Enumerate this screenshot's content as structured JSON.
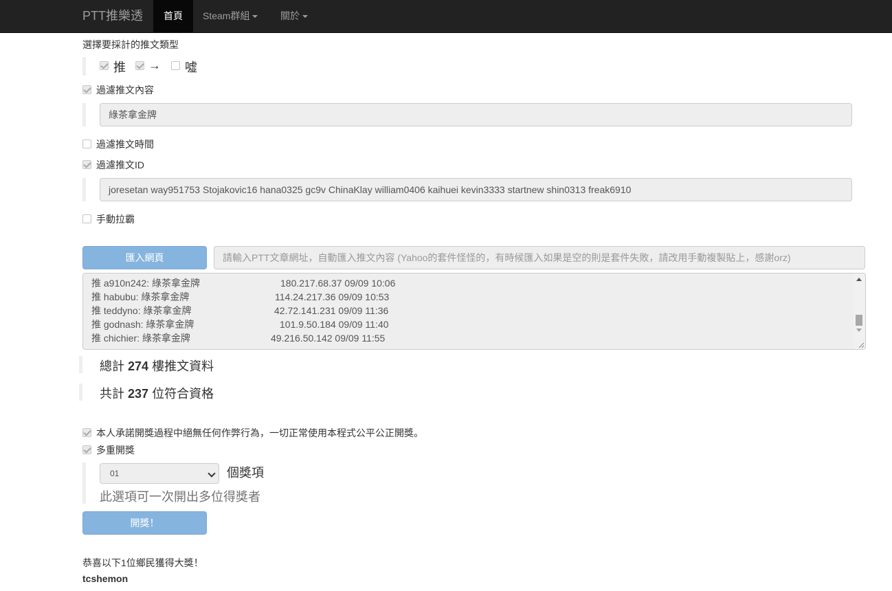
{
  "navbar": {
    "brand": "PTT推樂透",
    "items": [
      {
        "label": "首頁",
        "active": true
      },
      {
        "label": "Steam群組",
        "dropdown": true
      },
      {
        "label": "關於",
        "dropdown": true
      }
    ]
  },
  "push_type": {
    "label": "選擇要採計的推文類型",
    "options": [
      {
        "label": "推",
        "checked": true
      },
      {
        "label": "→",
        "checked": true
      },
      {
        "label": "噓",
        "checked": false
      }
    ]
  },
  "filter_content": {
    "label": "過濾推文內容",
    "checked": true,
    "value": "綠茶拿金牌"
  },
  "filter_time": {
    "label": "過濾推文時間",
    "checked": false
  },
  "filter_id": {
    "label": "過濾推文ID",
    "checked": true,
    "value": "joresetan way951753 Stojakovic16 hana0325 gc9v ChinaKlay william0406 kaihuei kevin3333 startnew shin0313 freak6910"
  },
  "manual": {
    "label": "手動拉霸",
    "checked": false
  },
  "import": {
    "button_label": "匯入網頁",
    "placeholder": "請輸入PTT文章網址，自動匯入推文內容 (Yahoo的套件怪怪的，有時候匯入如果是空的則是套件失敗，請改用手動複製貼上，感謝orz)"
  },
  "pushes": [
    {
      "text": "推 a910n242: 綠茶拿金牌",
      "meta": "180.217.68.37 09/09 10:06"
    },
    {
      "text": "推 habubu: 綠茶拿金牌",
      "meta": "114.24.217.36 09/09 10:53"
    },
    {
      "text": "推 teddyno: 綠茶拿金牌",
      "meta": "42.72.141.231 09/09 11:36"
    },
    {
      "text": "推 godnash: 綠茶拿金牌",
      "meta": "101.9.50.184 09/09 11:40"
    },
    {
      "text": "推 chichier: 綠茶拿金牌",
      "meta": "49.216.50.142 09/09 11:55"
    }
  ],
  "stats": {
    "total_prefix": "總計",
    "total_count": "274",
    "total_suffix": "樓推文資料",
    "qualified_prefix": "共計",
    "qualified_count": "237",
    "qualified_suffix": "位符合資格"
  },
  "pledge": {
    "label": "本人承諾開獎過程中絕無任何作弊行為，一切正常使用本程式公平公正開獎。",
    "checked": true
  },
  "multi": {
    "label": "多重開獎",
    "checked": true,
    "selected": "01",
    "suffix": "個獎項",
    "help": "此選項可一次開出多位得獎者"
  },
  "draw_button": "開獎！",
  "result": {
    "message": "恭喜以下1位鄉民獲得大獎！",
    "winner": "tcshemon"
  }
}
